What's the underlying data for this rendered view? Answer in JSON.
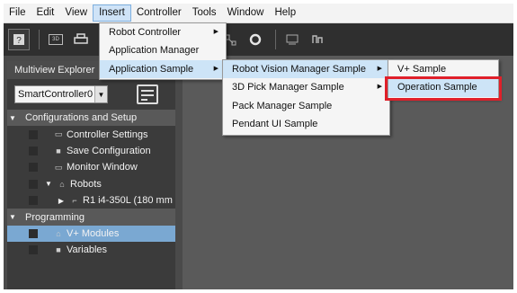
{
  "menubar": {
    "items": [
      "File",
      "Edit",
      "View",
      "Insert",
      "Controller",
      "Tools",
      "Window",
      "Help"
    ]
  },
  "panel": {
    "title": "Multiview Explorer",
    "controller_select": "SmartController0"
  },
  "tree": {
    "section_config": "Configurations and Setup",
    "controller_settings": "Controller Settings",
    "save_configuration": "Save Configuration",
    "monitor_window": "Monitor Window",
    "robots": "Robots",
    "robot_r1": "R1 i4-350L (180 mm",
    "section_programming": "Programming",
    "vplus_modules": "V+ Modules",
    "variables": "Variables"
  },
  "insert_menu": {
    "items": [
      {
        "label": "Robot Controller"
      },
      {
        "label": "Application Manager"
      },
      {
        "label": "Application Sample"
      }
    ]
  },
  "app_sample_menu": {
    "items": [
      {
        "label": "Robot Vision Manager Sample"
      },
      {
        "label": "3D Pick Manager Sample"
      },
      {
        "label": "Pack Manager Sample"
      },
      {
        "label": "Pendant UI Sample"
      }
    ]
  },
  "rvm_menu": {
    "items": [
      {
        "label": "V+ Sample"
      },
      {
        "label": "Operation Sample"
      }
    ]
  },
  "colors": {
    "highlight_box": "#e0202a",
    "menu_hover": "#cde4f7",
    "tree_selected": "#7aa8d2"
  },
  "icons": [
    "help-icon",
    "3d-view-icon",
    "printer-icon",
    "chevron-right-icon",
    "chevron-down-icon",
    "collapse-triangle-icon",
    "expand-triangle-icon"
  ]
}
